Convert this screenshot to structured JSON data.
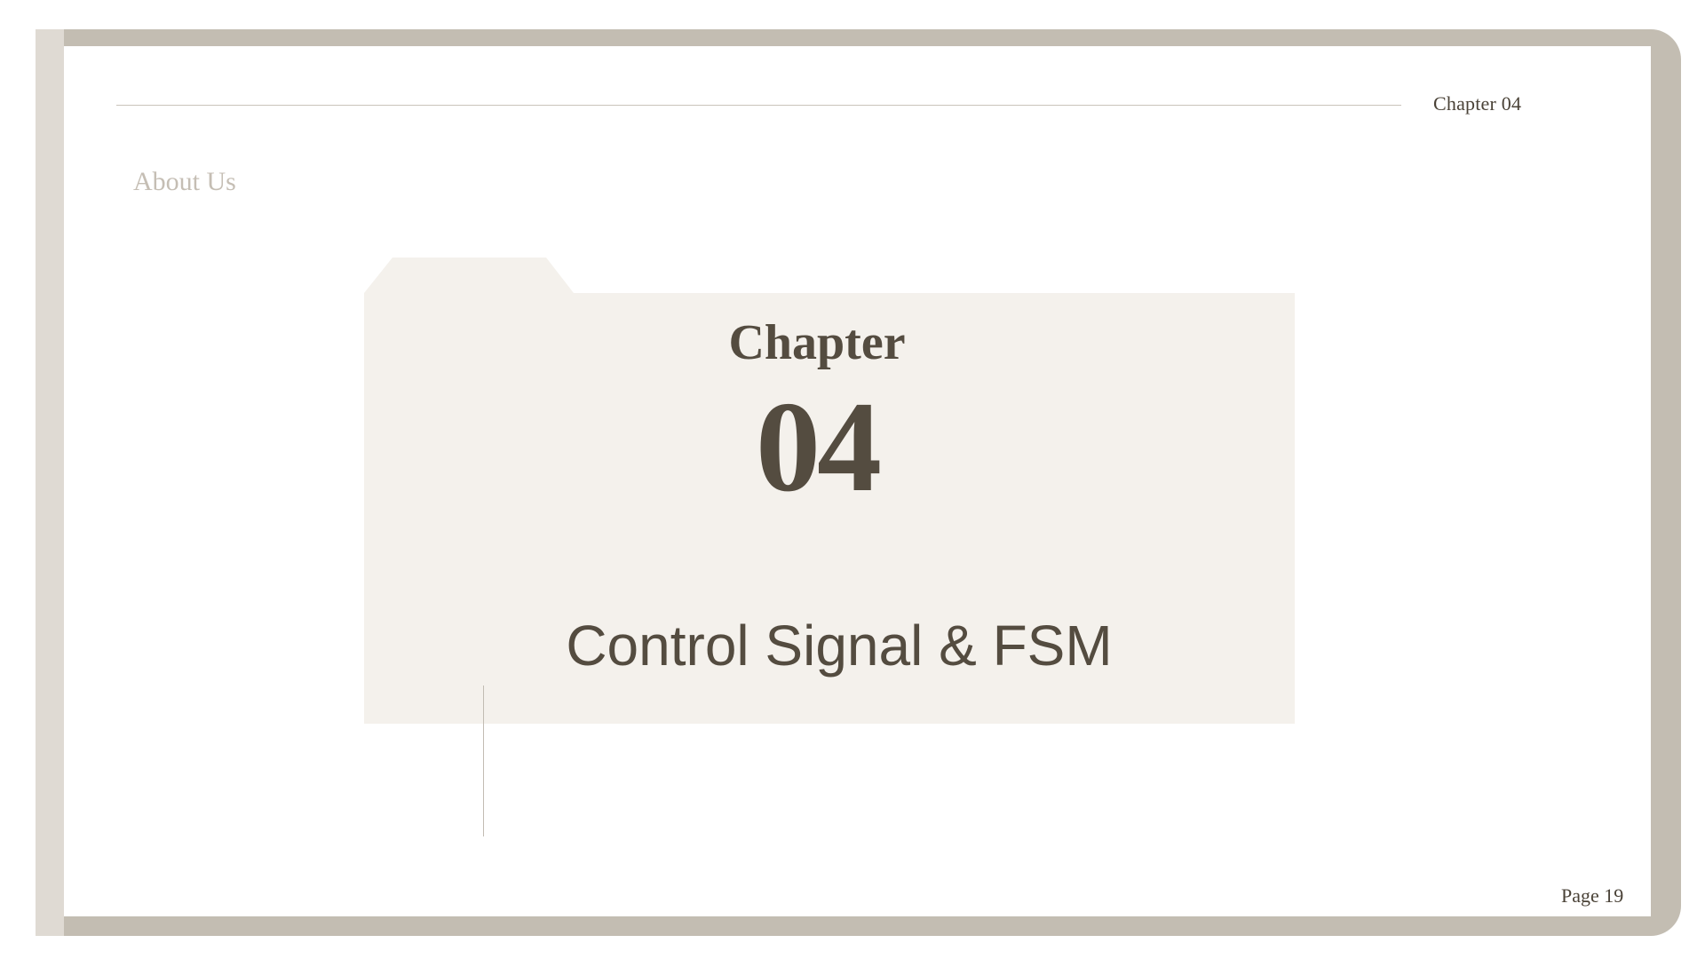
{
  "header": {
    "chapter_label": "Chapter 04"
  },
  "section": {
    "label": "About Us"
  },
  "chapter": {
    "word": "Chapter",
    "number": "04",
    "title": "Control Signal & FSM"
  },
  "footer": {
    "page_label": "Page 19"
  },
  "colors": {
    "frame": "#c3bdb2",
    "frame_left": "#dfdad3",
    "folder": "#f4f1ec",
    "text_dark": "#544c40",
    "text_muted": "#c5beb4"
  }
}
